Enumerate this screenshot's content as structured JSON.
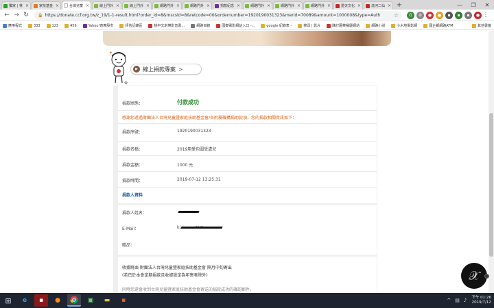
{
  "browser": {
    "tabs": [
      {
        "title": "獨家 | 林",
        "color": "#2ca02c"
      },
      {
        "title": "家扶基金",
        "color": "#e07a2a"
      },
      {
        "title": "台灣兒童",
        "color": "#ffffff",
        "active": true
      },
      {
        "title": "線上門外",
        "color": "#7dbb3c"
      },
      {
        "title": "線上門外",
        "color": "#7dbb3c"
      },
      {
        "title": "網路門外",
        "color": "#7dbb3c"
      },
      {
        "title": "網路門外",
        "color": "#7dbb3c"
      },
      {
        "title": "捐款紀念",
        "color": "#6b2fa0"
      },
      {
        "title": "網路門外",
        "color": "#7dbb3c"
      },
      {
        "title": "網路門外",
        "color": "#7dbb3c"
      },
      {
        "title": "網路門外",
        "color": "#7dbb3c"
      },
      {
        "title": "愛天文化",
        "color": "#c62828"
      },
      {
        "title": "流河二仙",
        "color": "#c62828"
      }
    ],
    "new_tab": "+",
    "window_controls": [
      "—",
      "❐",
      "✕"
    ],
    "url": "https://donate.ccf.org.tw/z_19/1-1-result.html?order_id=8&mscsid=8&retcode=00&ordernumber=1920190031323&merid=70089&amount=1000008&type=Auth",
    "bookmarks": [
      {
        "label": "應用程式",
        "color": "#4a7bd8"
      },
      {
        "label": "333",
        "color": "#e0b030"
      },
      {
        "label": "123",
        "color": "#e0b030"
      },
      {
        "label": "456",
        "color": "#e0b030"
      },
      {
        "label": "Yahoo!奇摩股市",
        "color": "#6b2fa0"
      },
      {
        "label": "評估記錄區",
        "color": "#e0b030"
      },
      {
        "label": "桃中文創樂影音書...",
        "color": "#cc3333"
      },
      {
        "label": "網路目錄",
        "color": "#777777"
      },
      {
        "label": "國泰電影網站入口 -...",
        "color": "#cc3333"
      },
      {
        "label": "google 紀錄表 -",
        "color": "#e0b030"
      },
      {
        "label": "搜尋 | 影片",
        "color": "#e0b030"
      },
      {
        "label": "陳訂園菜餐廳網站",
        "color": "#cc3333"
      },
      {
        "label": "網路小說",
        "color": "#e0b030"
      },
      {
        "label": "小木地電影網",
        "color": "#e0b030"
      },
      {
        "label": "國企銀網路ATM",
        "color": "#e0b030"
      }
    ],
    "bookmark_other": "其他書籤"
  },
  "page": {
    "header_title": "線上捐款專案",
    "status_label": "捐款狀態：",
    "status_value": "付款成功",
    "thanks_notice": "感謝您透過財團法人台灣兒童暨家庭扶助基金會/各附屬機構捐助款項，您的捐款相關資訊如下：",
    "fields": [
      {
        "label": "捐款序號：",
        "value": "1920190031323"
      },
      {
        "label": "捐款名稱：",
        "value": "2019用愛包圍受虐兒"
      },
      {
        "label": "捐款金額：",
        "value": "1000 元"
      },
      {
        "label": "捐款時間：",
        "value": "2019-07-12 13:25:31"
      }
    ],
    "donor_section": "捐款人資料",
    "donor_fields": [
      {
        "label": "捐款人姓名："
      },
      {
        "label": "E-Mail：",
        "value": "ki...........com"
      },
      {
        "label": "贈品："
      }
    ],
    "footer_line1": "收據將由 財團法人台灣兒童暨家庭扶助基金會 隔月中旬寄出",
    "footer_line2": "(若已於本會定期捐款且收據設定為年寄者除外)",
    "footer_line3": "同時您還會收到台灣兒童暨家庭扶助基金會寄送的捐款成功的確認郵件。"
  },
  "taskbar": {
    "clock_time": "下午 01:26",
    "clock_date": "2019/7/12"
  }
}
